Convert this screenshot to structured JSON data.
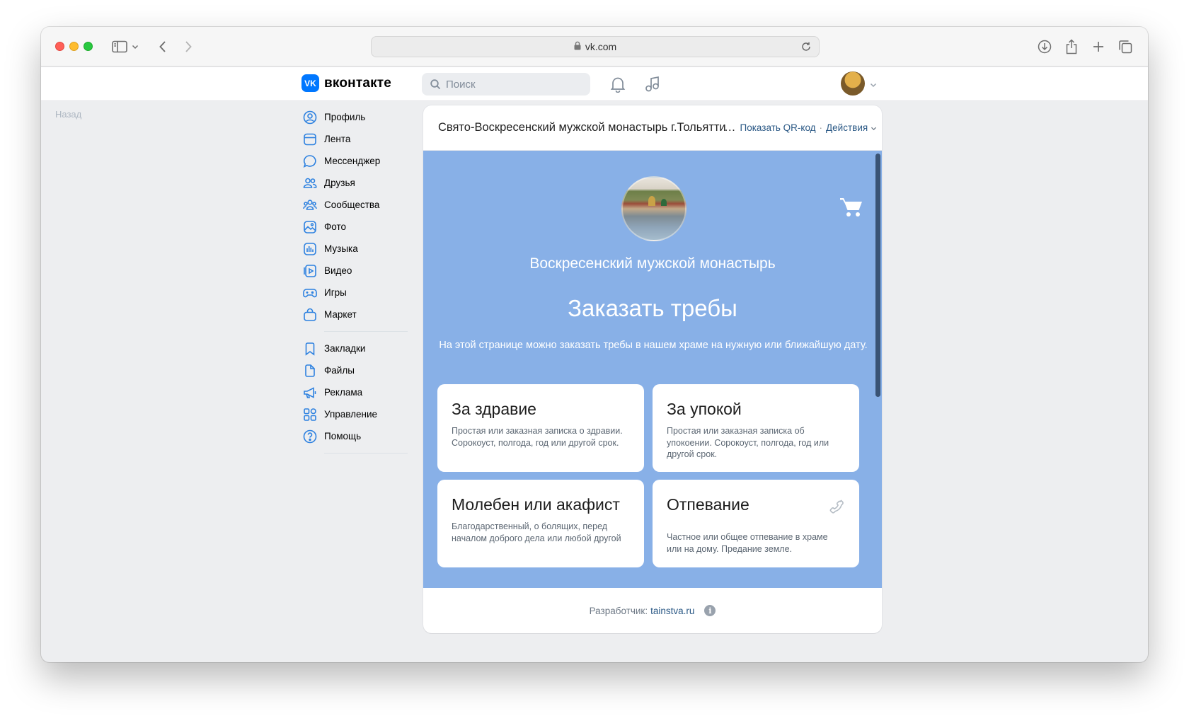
{
  "browser": {
    "url": "vk.com"
  },
  "header": {
    "logo_text": "вконтакте",
    "search_placeholder": "Поиск"
  },
  "back_label": "Назад",
  "sidebar": {
    "items": [
      {
        "label": "Профиль",
        "icon": "profile-icon"
      },
      {
        "label": "Лента",
        "icon": "feed-icon"
      },
      {
        "label": "Мессенджер",
        "icon": "messenger-icon"
      },
      {
        "label": "Друзья",
        "icon": "friends-icon"
      },
      {
        "label": "Сообщества",
        "icon": "communities-icon"
      },
      {
        "label": "Фото",
        "icon": "photo-icon"
      },
      {
        "label": "Музыка",
        "icon": "music-icon"
      },
      {
        "label": "Видео",
        "icon": "video-icon"
      },
      {
        "label": "Игры",
        "icon": "games-icon"
      },
      {
        "label": "Маркет",
        "icon": "market-icon"
      }
    ],
    "items2": [
      {
        "label": "Закладки",
        "icon": "bookmarks-icon"
      },
      {
        "label": "Файлы",
        "icon": "files-icon"
      },
      {
        "label": "Реклама",
        "icon": "ads-icon"
      },
      {
        "label": "Управление",
        "icon": "manage-icon"
      },
      {
        "label": "Помощь",
        "icon": "help-icon"
      }
    ]
  },
  "card": {
    "title": "Свято-Воскресенский мужской монастырь г.Тольятти",
    "qr_link": "Показать QR-код",
    "actions": "Действия"
  },
  "app": {
    "group_name": "Воскресенский мужской монастырь",
    "title": "Заказать требы",
    "description": "На этой странице можно заказать требы в нашем  храме на нужную или ближайшую дату.",
    "tiles": [
      {
        "title": "За здравие",
        "desc": "Простая или заказная записка о здравии. Сорокоуст, полгода, год или другой срок."
      },
      {
        "title": "За упокой",
        "desc": "Простая или заказная записка об упокоении. Сорокоуст, полгода, год или другой срок."
      },
      {
        "title": "Молебен или акафист",
        "desc": "Благодарственный, о болящих, перед началом доброго дела или любой другой"
      },
      {
        "title": "Отпевание",
        "desc": "Частное или общее отпевание в храме или на дому. Предание земле."
      }
    ]
  },
  "footer": {
    "developer_label": "Разработчик:",
    "developer_link": "tainstva.ru",
    "info_glyph": "i"
  },
  "colors": {
    "app_background": "#88b0e7",
    "vk_blue": "#0077ff",
    "link": "#2a5885"
  }
}
